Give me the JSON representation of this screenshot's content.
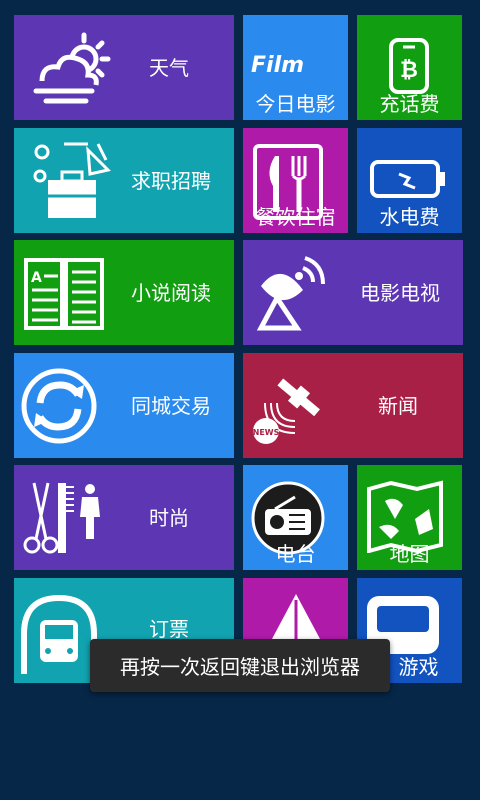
{
  "colors": {
    "background": "#062748",
    "purple": "#5d37b3",
    "teal": "#12a3b0",
    "green": "#119e11",
    "blue": "#2a8aee",
    "crimson": "#a82045",
    "magenta": "#b01aa8",
    "navy": "#1253c0"
  },
  "tiles": {
    "weather": {
      "label": "天气",
      "icon": "cloud-sun-icon"
    },
    "movies_today": {
      "label": "今日电影",
      "icon": "film-logo-icon",
      "logo_text": "Film"
    },
    "recharge": {
      "label": "充话费",
      "icon": "phone-bitcoin-icon"
    },
    "jobs": {
      "label": "求职招聘",
      "icon": "briefcase-icon"
    },
    "dining": {
      "label": "餐饮住宿",
      "icon": "fork-knife-icon"
    },
    "utilities": {
      "label": "水电费",
      "icon": "battery-icon"
    },
    "novels": {
      "label": "小说阅读",
      "icon": "book-icon"
    },
    "movies_tv": {
      "label": "电影电视",
      "icon": "satellite-dish-icon"
    },
    "trade": {
      "label": "同城交易",
      "icon": "refresh-icon"
    },
    "news": {
      "label": "新闻",
      "icon": "satellite-news-icon",
      "badge_text": "NEWS"
    },
    "fashion": {
      "label": "时尚",
      "icon": "scissors-comb-icon"
    },
    "radio": {
      "label": "电台",
      "icon": "radio-icon"
    },
    "map": {
      "label": "地图",
      "icon": "map-icon"
    },
    "tickets": {
      "label": "订票",
      "icon": "train-icon"
    },
    "games": {
      "label": "游戏",
      "icon": "gamepad-icon"
    }
  },
  "toast": {
    "message": "再按一次返回键退出浏览器"
  }
}
